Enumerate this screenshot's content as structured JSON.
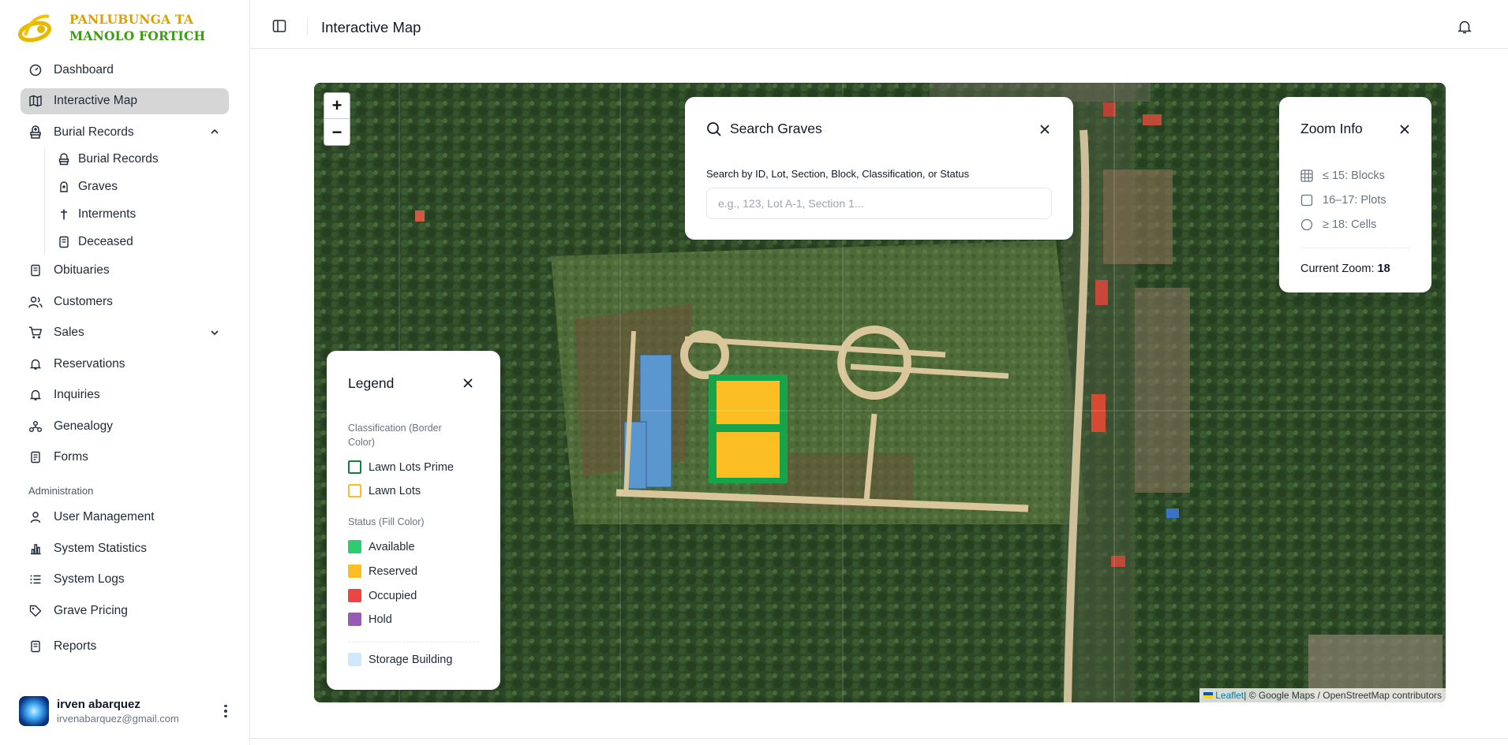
{
  "brand": {
    "line1": "PANLUBUNGA TA",
    "line2": "MANOLO FORTICH"
  },
  "sidebar": {
    "items": [
      {
        "label": "Dashboard",
        "icon": "gauge-icon"
      },
      {
        "label": "Interactive Map",
        "icon": "map-icon",
        "active": true
      },
      {
        "label": "Burial Records",
        "icon": "headstone-icon",
        "expanded": true
      },
      {
        "label": "Obituaries",
        "icon": "document-icon"
      },
      {
        "label": "Customers",
        "icon": "users-icon"
      },
      {
        "label": "Sales",
        "icon": "cart-icon",
        "expanded": false
      },
      {
        "label": "Reservations",
        "icon": "bell-icon"
      },
      {
        "label": "Inquiries",
        "icon": "bell-icon"
      },
      {
        "label": "Genealogy",
        "icon": "tree-icon"
      },
      {
        "label": "Forms",
        "icon": "form-icon"
      }
    ],
    "burial_sub": [
      {
        "label": "Burial Records",
        "icon": "headstone-icon"
      },
      {
        "label": "Graves",
        "icon": "grave-icon"
      },
      {
        "label": "Interments",
        "icon": "cross-icon"
      },
      {
        "label": "Deceased",
        "icon": "document-icon"
      }
    ],
    "admin_label": "Administration",
    "admin": [
      {
        "label": "User Management",
        "icon": "user-icon"
      },
      {
        "label": "System Statistics",
        "icon": "bar-chart-icon"
      },
      {
        "label": "System Logs",
        "icon": "list-icon"
      },
      {
        "label": "Grave Pricing",
        "icon": "tag-icon"
      }
    ],
    "reports": {
      "label": "Reports",
      "icon": "document-icon"
    }
  },
  "user": {
    "name": "irven abarquez",
    "email": "irvenabarquez@gmail.com"
  },
  "header": {
    "title": "Interactive Map"
  },
  "map": {
    "zoom_in": "+",
    "zoom_out": "−",
    "attribution_link": "Leaflet",
    "attribution_rest": " | © Google Maps / OpenStreetMap contributors"
  },
  "search": {
    "title": "Search Graves",
    "label": "Search by ID, Lot, Section, Block, Classification, or Status",
    "placeholder": "e.g., 123, Lot A-1, Section 1...",
    "value": ""
  },
  "zoom_info": {
    "title": "Zoom Info",
    "rows": [
      "≤ 15: Blocks",
      "16–17: Plots",
      "≥ 18: Cells"
    ],
    "current_label": "Current Zoom: ",
    "current_value": "18"
  },
  "legend": {
    "title": "Legend",
    "classification_heading": "Classification (Border Color)",
    "classification": [
      {
        "label": "Lawn Lots Prime",
        "color": "#15803d"
      },
      {
        "label": "Lawn Lots",
        "color": "#fbbf24"
      }
    ],
    "status_heading": "Status (Fill Color)",
    "status": [
      {
        "label": "Available",
        "color": "#2ecc71"
      },
      {
        "label": "Reserved",
        "color": "#fbbf24"
      },
      {
        "label": "Occupied",
        "color": "#ef4444"
      },
      {
        "label": "Hold",
        "color": "#9b59b6"
      }
    ],
    "storage": {
      "label": "Storage Building",
      "color": "#cfe8fc"
    }
  }
}
